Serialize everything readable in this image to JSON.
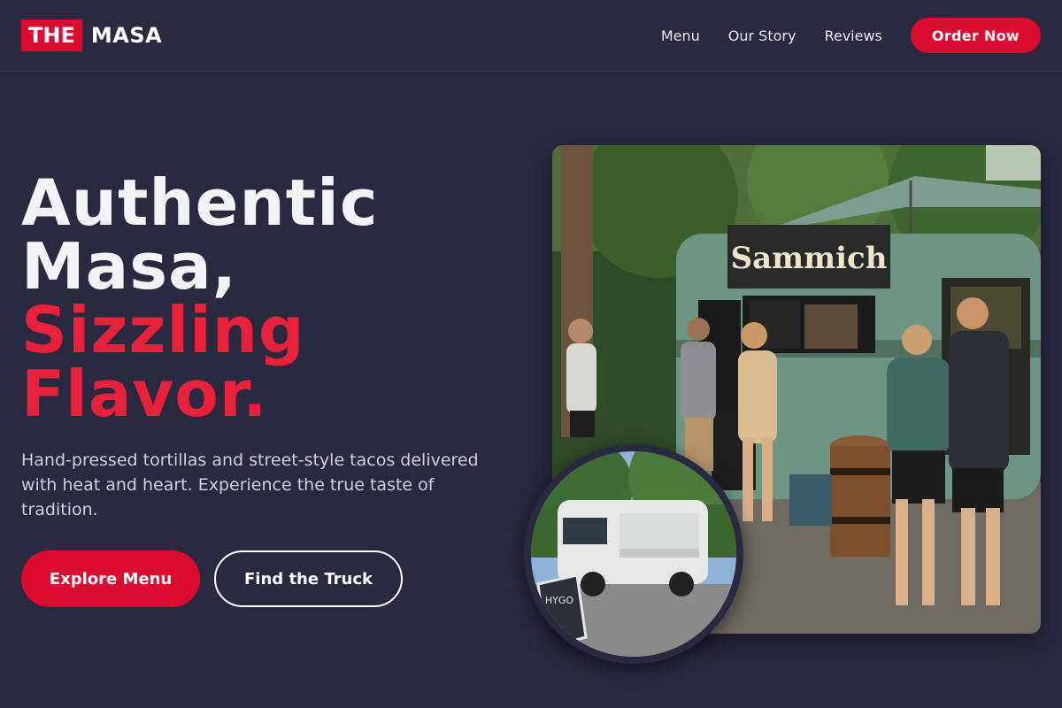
{
  "brand": {
    "box_text": "THE",
    "name": "MASA",
    "accent_color": "#dc0c30",
    "background_color": "#292a40"
  },
  "nav": {
    "links": [
      "Menu",
      "Our Story",
      "Reviews"
    ],
    "cta_label": "Order Now"
  },
  "hero": {
    "title_line1": "Authentic",
    "title_line2": "Masa,",
    "title_line3": "Sizzling",
    "title_line4": "Flavor.",
    "description": "Hand-pressed tortillas and street-style tacos delivered with heat and heart. Experience the true taste of tradition.",
    "primary_button": "Explore Menu",
    "secondary_button": "Find the Truck"
  },
  "images": {
    "main_sign_text": "Sammich",
    "inset_board_text": "HYGO"
  }
}
